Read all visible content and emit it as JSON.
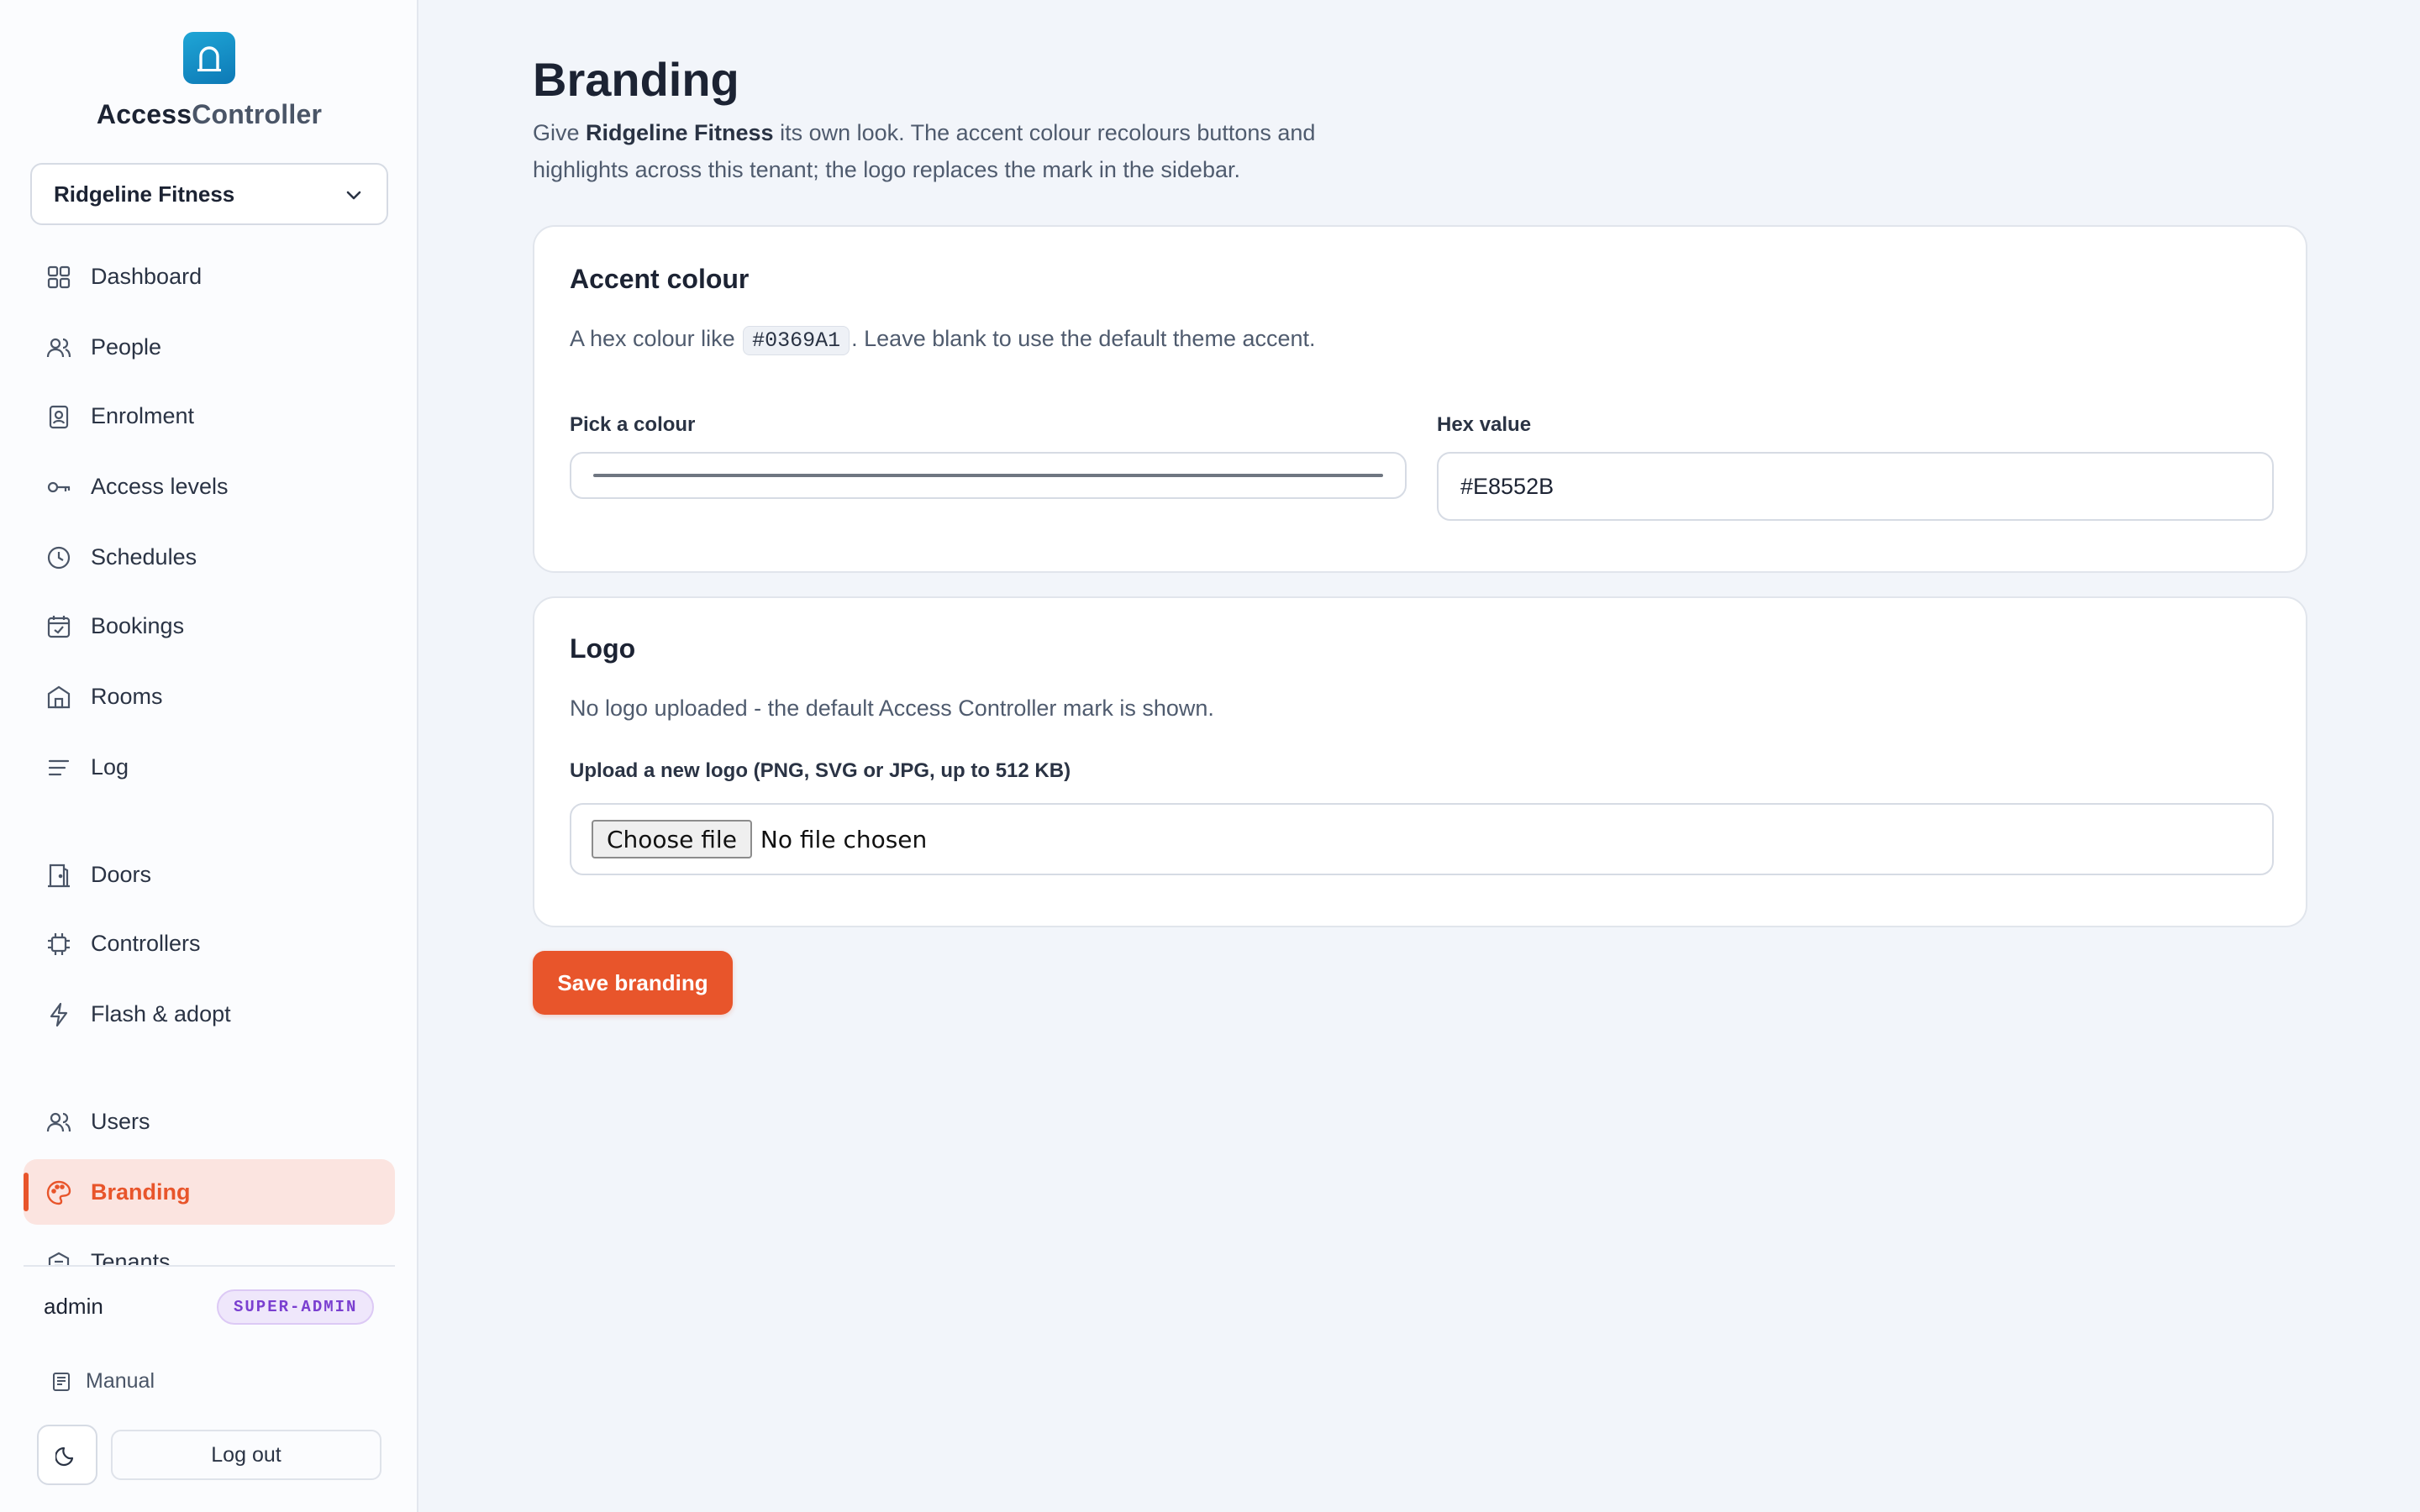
{
  "app": {
    "brand_part1": "Access",
    "brand_part2": "Controller",
    "accent_color": "#e8552b"
  },
  "sidebar": {
    "tenant": "Ridgeline Fitness",
    "nav": [
      {
        "label": "Dashboard",
        "icon": "grid-icon"
      },
      {
        "label": "People",
        "icon": "people-icon"
      },
      {
        "label": "Enrolment",
        "icon": "badge-icon"
      },
      {
        "label": "Access levels",
        "icon": "key-icon"
      },
      {
        "label": "Schedules",
        "icon": "clock-icon"
      },
      {
        "label": "Bookings",
        "icon": "calendar-icon"
      },
      {
        "label": "Rooms",
        "icon": "room-icon"
      },
      {
        "label": "Log",
        "icon": "list-icon"
      },
      {
        "label": "Doors",
        "icon": "door-icon"
      },
      {
        "label": "Controllers",
        "icon": "chip-icon"
      },
      {
        "label": "Flash & adopt",
        "icon": "bolt-icon"
      },
      {
        "label": "Users",
        "icon": "users-icon"
      },
      {
        "label": "Branding",
        "icon": "palette-icon",
        "active": true
      },
      {
        "label": "Tenants",
        "icon": "building-icon"
      }
    ],
    "user": "admin",
    "role": "SUPER-ADMIN",
    "manual": "Manual",
    "logout": "Log out"
  },
  "main": {
    "title": "Branding",
    "desc_prefix": "Give ",
    "desc_tenant": "Ridgeline Fitness",
    "desc_suffix": " its own look. The accent colour recolours buttons and highlights across this tenant; the logo replaces the mark in the sidebar.",
    "accent_card": {
      "title": "Accent colour",
      "hint_prefix": "A hex colour like ",
      "hint_code": "#0369A1",
      "hint_suffix": ". Leave blank to use the default theme accent.",
      "picker_label": "Pick a colour",
      "hex_label": "Hex value",
      "hex_value": "#E8552B"
    },
    "logo_card": {
      "title": "Logo",
      "status": "No logo uploaded - the default Access Controller mark is shown.",
      "upload_label": "Upload a new logo (PNG, SVG or JPG, up to 512 KB)",
      "choose_file": "Choose file",
      "no_file": "No file chosen"
    },
    "save_label": "Save branding"
  }
}
